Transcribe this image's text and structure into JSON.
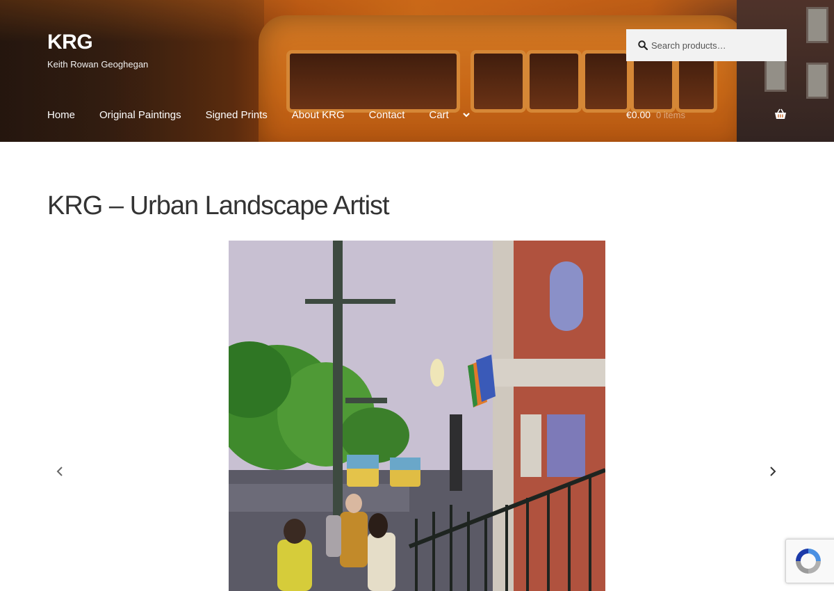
{
  "site": {
    "title": "KRG",
    "description": "Keith Rowan Geoghegan"
  },
  "search": {
    "placeholder": "Search products…"
  },
  "nav": {
    "items": [
      {
        "label": "Home"
      },
      {
        "label": "Original Paintings"
      },
      {
        "label": "Signed Prints"
      },
      {
        "label": "About KRG"
      },
      {
        "label": "Contact"
      },
      {
        "label": "Cart"
      }
    ]
  },
  "cart": {
    "amount": "€0.00",
    "count": "0 items"
  },
  "page": {
    "title": "KRG – Urban Landscape Artist"
  },
  "icons": {
    "search": "search-icon",
    "cart": "basket-icon",
    "dropdown": "chevron-down-icon",
    "prev": "chevron-left-icon",
    "next": "chevron-right-icon",
    "recaptcha": "recaptcha-icon"
  },
  "colors": {
    "header_bg": "#d9691a",
    "text": "#333333",
    "white": "#ffffff"
  }
}
